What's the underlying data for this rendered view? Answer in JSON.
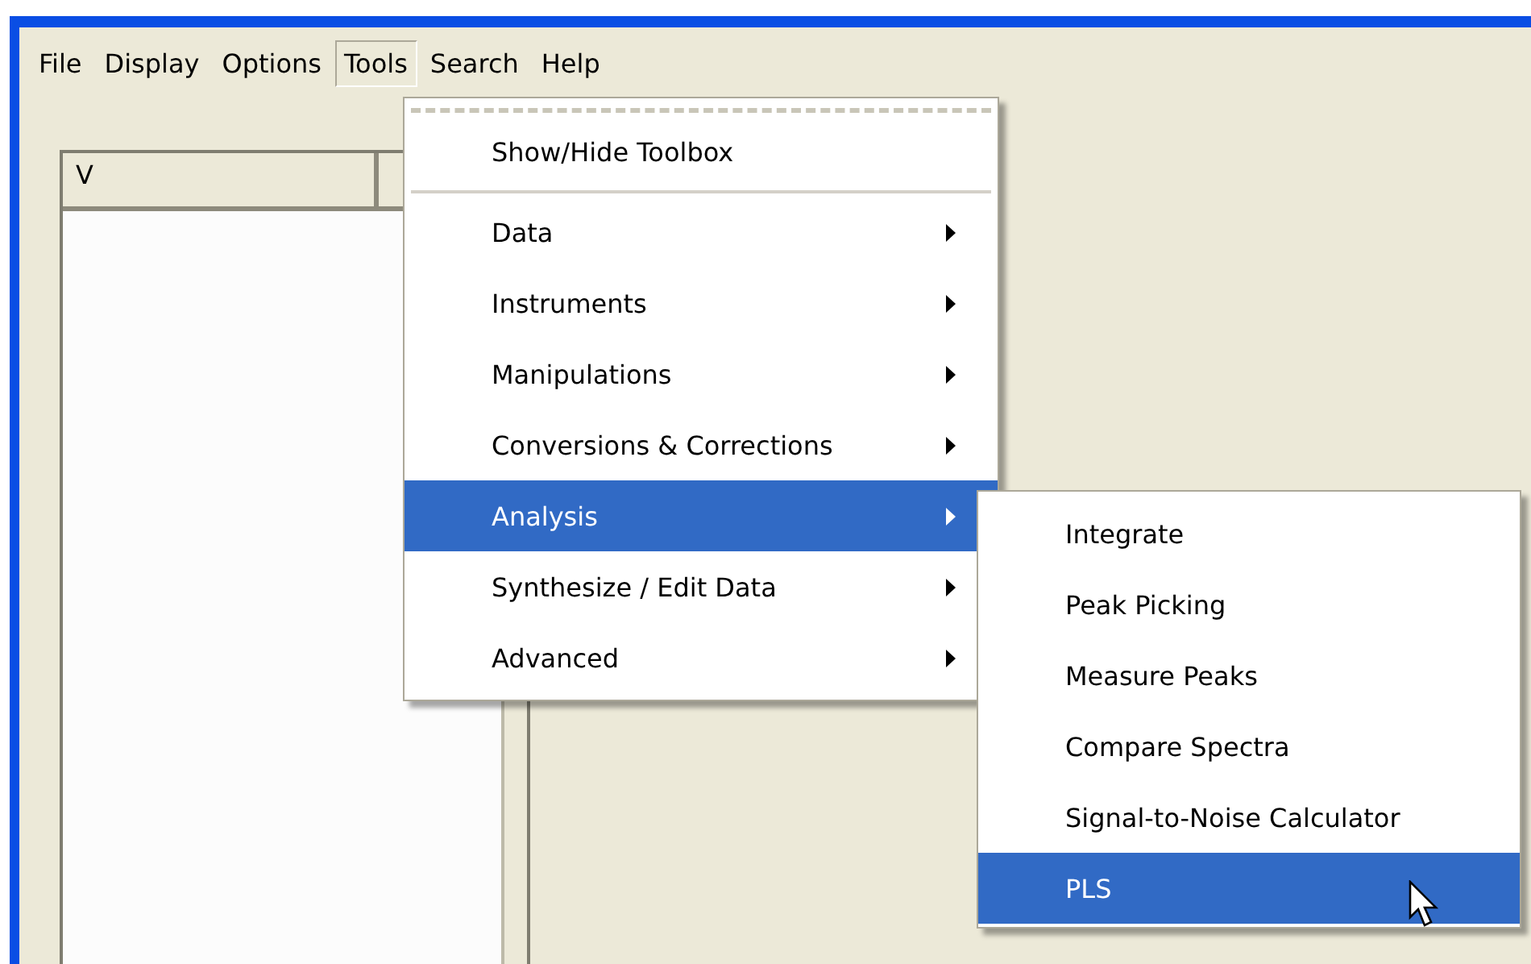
{
  "menubar": [
    {
      "label": "File",
      "selected": false
    },
    {
      "label": "Display",
      "selected": false
    },
    {
      "label": "Options",
      "selected": false
    },
    {
      "label": "Tools",
      "selected": true
    },
    {
      "label": "Search",
      "selected": false
    },
    {
      "label": "Help",
      "selected": false
    }
  ],
  "list": {
    "columns": [
      "V"
    ]
  },
  "tools_menu": {
    "tear_off": true,
    "items": [
      {
        "kind": "command",
        "label": "Show/Hide Toolbox",
        "selected": false
      },
      {
        "kind": "separator"
      },
      {
        "kind": "submenu",
        "label": "Data",
        "selected": false
      },
      {
        "kind": "submenu",
        "label": "Instruments",
        "selected": false
      },
      {
        "kind": "submenu",
        "label": "Manipulations",
        "selected": false
      },
      {
        "kind": "submenu",
        "label": "Conversions & Corrections",
        "selected": false
      },
      {
        "kind": "submenu",
        "label": "Analysis",
        "selected": true
      },
      {
        "kind": "submenu",
        "label": "Synthesize / Edit Data",
        "selected": false
      },
      {
        "kind": "submenu",
        "label": "Advanced",
        "selected": false
      }
    ]
  },
  "analysis_submenu": {
    "items": [
      {
        "label": "Integrate",
        "selected": false
      },
      {
        "label": "Peak Picking",
        "selected": false
      },
      {
        "label": "Measure Peaks",
        "selected": false
      },
      {
        "label": "Compare Spectra",
        "selected": false
      },
      {
        "label": "Signal-to-Noise Calculator",
        "selected": false
      },
      {
        "label": "PLS",
        "selected": true
      }
    ]
  }
}
